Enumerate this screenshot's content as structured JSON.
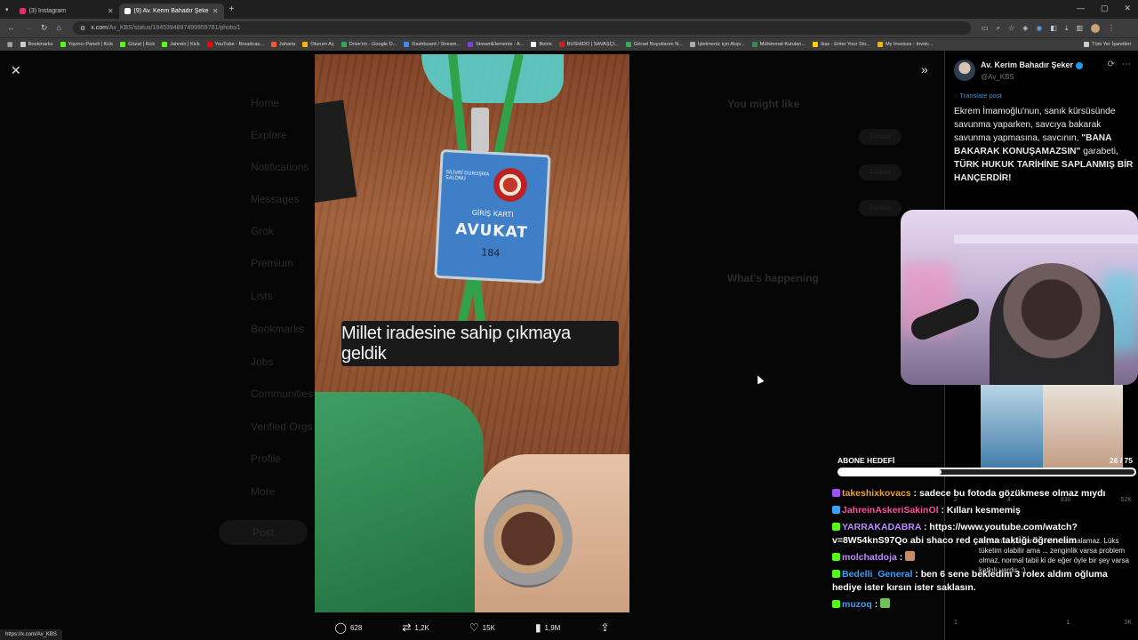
{
  "browser": {
    "tabs": [
      {
        "label": "(3) Instagram",
        "color": "#e1306c"
      },
      {
        "label": "(9) Av. Kerim Bahadır Şeker (@Av",
        "color": "#ffffff"
      }
    ],
    "url_host": "x.com",
    "url_path": "/Av_KBS/status/1945394897499959781/photo/1",
    "bookmarks": [
      {
        "label": "Bookmarks",
        "color": "#cccccc"
      },
      {
        "label": "Yayıncı Paneli | Kick",
        "color": "#53fc18"
      },
      {
        "label": "Gözat | Kick",
        "color": "#53fc18"
      },
      {
        "label": "Jahrein | Kick",
        "color": "#53fc18"
      },
      {
        "label": "YouTube - Broadcas...",
        "color": "#ff0000"
      },
      {
        "label": "Jaharia",
        "color": "#ff5533"
      },
      {
        "label": "Oturum Aç",
        "color": "#f4b400"
      },
      {
        "label": "Drive'ım - Google D...",
        "color": "#34a853"
      },
      {
        "label": "Dashboard / Stream...",
        "color": "#4285f4"
      },
      {
        "label": "StreamElements - A...",
        "color": "#7b3fe4"
      },
      {
        "label": "Botrix",
        "color": "#ffffff"
      },
      {
        "label": "BUSHIDO | SAVAŞÇI...",
        "color": "#cc2222"
      },
      {
        "label": "Görsel Boyutlarını N...",
        "color": "#33aa55"
      },
      {
        "label": "İşletmeniz için Alışv...",
        "color": "#aaaaaa"
      },
      {
        "label": "Mühimmat Kutuları...",
        "color": "#2e8b57"
      },
      {
        "label": "ikas - Enter Your Sto...",
        "color": "#ffcc00"
      },
      {
        "label": "My Invoices - Invoic...",
        "color": "#f4b400"
      },
      {
        "label": "Tüm Yer İşaretleri",
        "color": "#cccccc"
      }
    ]
  },
  "background_nav": {
    "items": [
      "Home",
      "Explore",
      "Notifications",
      "Messages",
      "Grok",
      "Premium",
      "Lists",
      "Bookmarks",
      "Jobs",
      "Communities",
      "Verified Orgs",
      "Profile",
      "More"
    ],
    "post_button": "Post",
    "you_might_like": "You might like",
    "whats_happening": "What's happening",
    "follow": "Follow"
  },
  "photo": {
    "caption": "Millet iradesine sahip çıkmaya geldik",
    "badge_top": "SİLİVRİ DURUŞMA SALONU",
    "badge_card": "GİRİŞ KARTI",
    "badge_role": "AVUKAT",
    "badge_number": "184"
  },
  "actions": {
    "replies": "628",
    "reposts": "1,2K",
    "likes": "15K",
    "views": "1,9M"
  },
  "tweet": {
    "author": "Av. Kerim Bahadır Şeker",
    "handle": "@Av_KBS",
    "translate": "Translate post",
    "text_part1": "Ekrem İmamoğlu'nun, sanık kürsüsünde savunma yaparken, savcıya bakarak savunma yapmasına, savcının, ",
    "text_bold1": "\"BANA BAKARAK KONUŞAMAZSIN\"",
    "text_part2": " garabeti, ",
    "text_bold2": "TÜRK HUKUK TARİHİNE SAPLANMIŞ BİR HANÇERDİR!",
    "reply_handle": "@kiyiclugur · Jul 17",
    "reply_text": "Hiç kimse çalışarak, rolex saat alamaz. Lüks tüketim olabilir ama ... zenginlik varsa problem olmaz, normal tabii ki de eğer öyle bir şey varsa katkılı vardır. :)",
    "stats_a": [
      "2",
      "4",
      "830",
      "52K"
    ],
    "stats_b": [
      "1",
      "",
      "1",
      "3K"
    ]
  },
  "sub_goal": {
    "label": "ABONE HEDEFİ",
    "current": 26,
    "target": 75,
    "count_text": "26  / 75",
    "progress": 0.347
  },
  "chat": [
    {
      "user": "takeshixkovacs",
      "color": "#f0a030",
      "badge": "#a050ff",
      "text": "sadece bu fotoda gözükmese olmaz mıydı"
    },
    {
      "user": "JahreinAskeriSakinOl",
      "color": "#ff4fa0",
      "badge": "#3aa0ff",
      "text": "Kılları kesmemiş"
    },
    {
      "user": "YARRAKADABRA",
      "color": "#c08aff",
      "badge": "#53fc18",
      "text": "https://www.youtube.com/watch?v=8W54knS97Qo abi shaco red çalma taktiği öğrenelim"
    },
    {
      "user": "molchatdoja",
      "color": "#c08aff",
      "badge": "#53fc18",
      "text": ""
    },
    {
      "user": "Bedelli_General",
      "color": "#3aa0ff",
      "badge": "#53fc18",
      "text": "ben 6 sene bekledim 3 rolex aldım oğluma hediye ister kırsın ister saklasın."
    },
    {
      "user": "muzoq",
      "color": "#3aa0ff",
      "badge": "#53fc18",
      "text": ""
    }
  ],
  "status_url": "https://x.com/Av_KBS"
}
